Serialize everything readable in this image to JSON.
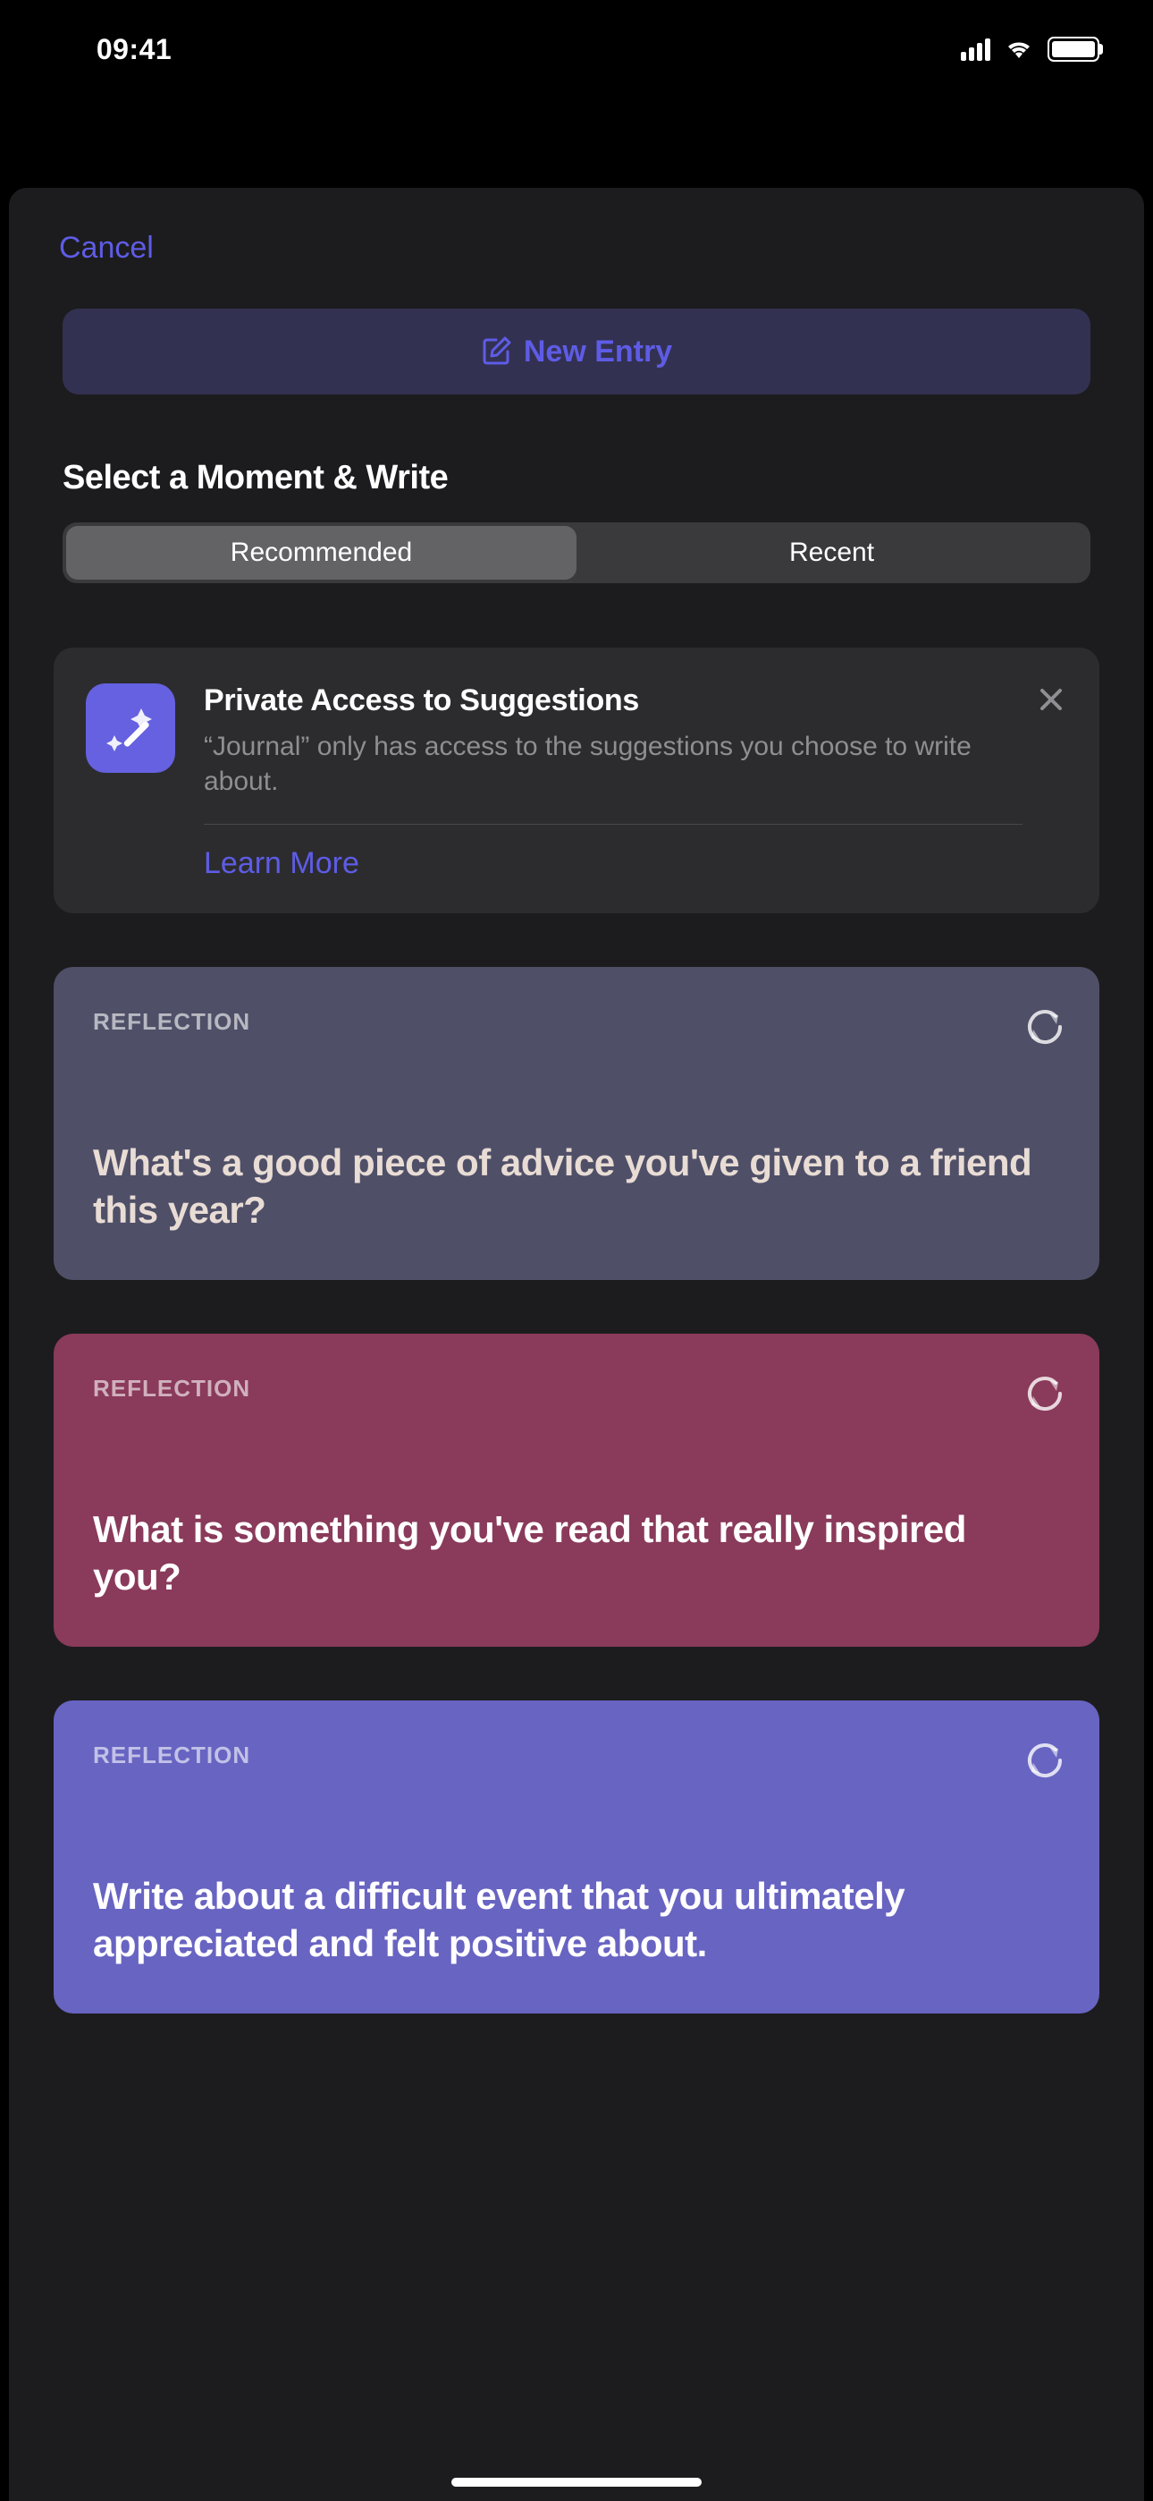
{
  "statusBar": {
    "time": "09:41"
  },
  "header": {
    "cancel": "Cancel",
    "newEntry": "New Entry"
  },
  "section": {
    "title": "Select a Moment & Write"
  },
  "tabs": {
    "recommended": "Recommended",
    "recent": "Recent"
  },
  "privacy": {
    "title": "Private Access to Suggestions",
    "description": "“Journal” only has access to the suggestions you choose to write about.",
    "learnMore": "Learn More"
  },
  "cards": [
    {
      "label": "REFLECTION",
      "prompt": "What's a good piece of advice you've given to a friend this year?"
    },
    {
      "label": "REFLECTION",
      "prompt": "What is something you've read that really inspired you?"
    },
    {
      "label": "REFLECTION",
      "prompt": "Write about a difficult event that you ultimately appreciated and felt positive about."
    }
  ]
}
